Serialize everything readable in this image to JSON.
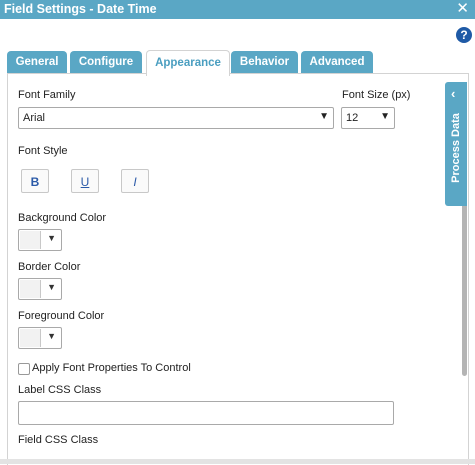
{
  "window": {
    "title": "Field Settings - Date Time",
    "close_icon": "close-icon"
  },
  "help": {
    "icon": "help-icon",
    "glyph": "?"
  },
  "tabs": [
    {
      "label": "General",
      "active": false
    },
    {
      "label": "Configure",
      "active": false
    },
    {
      "label": "Appearance",
      "active": true
    },
    {
      "label": "Behavior",
      "active": false
    },
    {
      "label": "Advanced",
      "active": false
    }
  ],
  "appearance": {
    "font_family": {
      "label": "Font Family",
      "value": "Arial"
    },
    "font_size": {
      "label": "Font Size",
      "unit": "(px)",
      "value": "12"
    },
    "font_style": {
      "label": "Font Style",
      "bold": "B",
      "underline": "U",
      "italic": "I"
    },
    "background_color": {
      "label": "Background Color"
    },
    "border_color": {
      "label": "Border Color"
    },
    "foreground_color": {
      "label": "Foreground Color"
    },
    "apply_font": {
      "label": "Apply Font Properties To Control",
      "checked": false
    },
    "label_css": {
      "label": "Label CSS Class",
      "value": ""
    },
    "field_css": {
      "label": "Field CSS Class"
    }
  },
  "side_panel": {
    "label": "Process Data",
    "chevron": "‹"
  },
  "colors": {
    "accent": "#5aa7c5",
    "help": "#1f5aa6"
  }
}
